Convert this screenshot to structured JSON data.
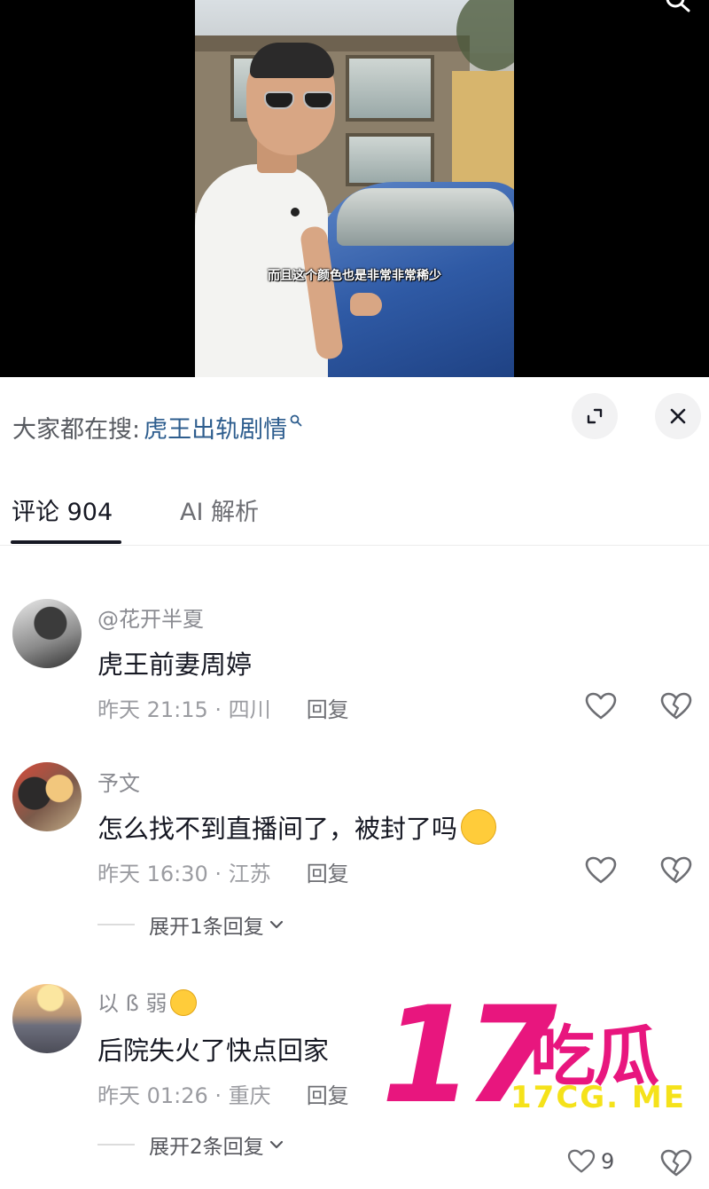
{
  "video": {
    "subtitle": "而且这个颜色也是非常非常稀少"
  },
  "search_bar": {
    "prefix": "大家都在搜:",
    "term": "虎王出轨剧情"
  },
  "tabs": [
    {
      "label": "评论 904",
      "active": true
    },
    {
      "label": "AI 解析",
      "active": false
    }
  ],
  "comments": [
    {
      "author": "@花开半夏",
      "text": "虎王前妻周婷",
      "time_location": "昨天 21:15 · 四川",
      "reply_label": "回复"
    },
    {
      "author": "予文",
      "text": "怎么找不到直播间了，被封了吗",
      "emoji": "surprised-face-emoji",
      "time_location": "昨天 16:30 · 江苏",
      "reply_label": "回复",
      "expand_replies": "展开1条回复"
    },
    {
      "author": "以 ß 弱",
      "author_emoji": "hugging-face-emoji",
      "text": "后院失火了快点回家",
      "time_location": "昨天 01:26 · 重庆",
      "reply_label": "回复",
      "expand_replies": "展开2条回复",
      "like_count": "9"
    }
  ],
  "watermark": {
    "number": "17",
    "chinese": "吃瓜",
    "domain": "17CG. ME"
  },
  "colors": {
    "accent_link": "#2d5d8e",
    "watermark_pink": "#e8167e",
    "watermark_yellow": "#f5e21a"
  }
}
